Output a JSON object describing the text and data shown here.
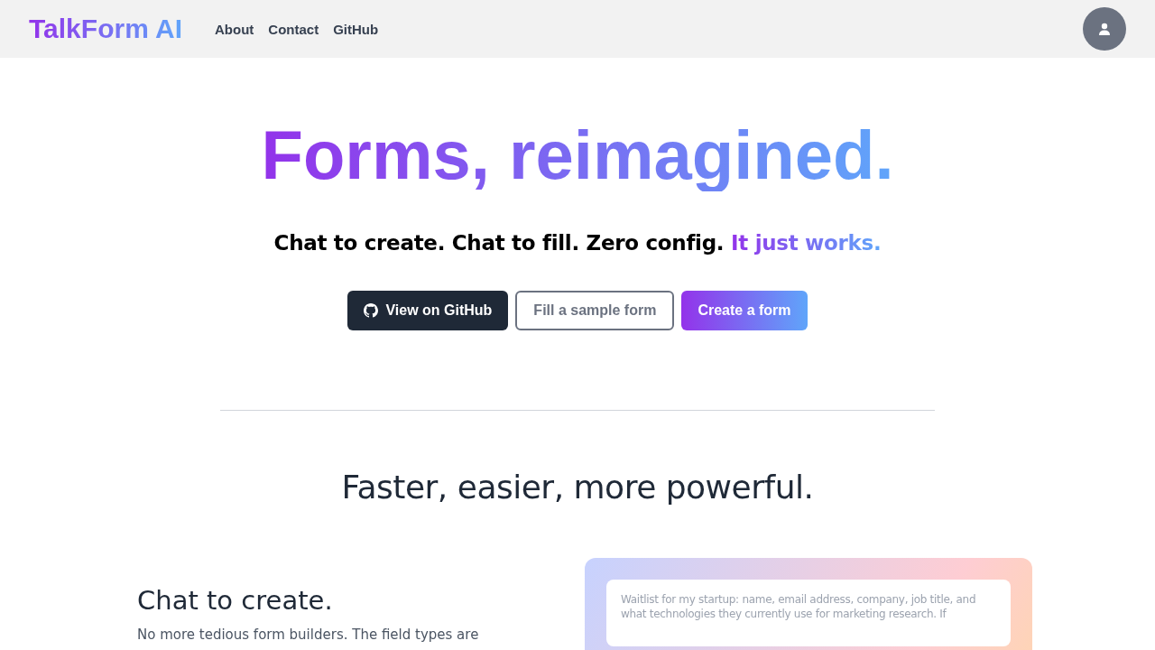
{
  "header": {
    "logo": "TalkForm AI",
    "nav": [
      {
        "label": "About"
      },
      {
        "label": "Contact"
      },
      {
        "label": "GitHub"
      }
    ]
  },
  "hero": {
    "title": "Forms, reimagined.",
    "subtitle_plain": "Chat to create. Chat to fill. Zero config.",
    "subtitle_accent": "It just works.",
    "buttons": [
      {
        "label": "View on GitHub",
        "kind": "dark"
      },
      {
        "label": "Fill a sample form",
        "kind": "outline"
      },
      {
        "label": "Create a form",
        "kind": "gradient"
      }
    ]
  },
  "features": {
    "heading": "Faster, easier, more powerful.",
    "section_title": "Chat to create.",
    "section_text": "No more tedious form builders. The field types are",
    "prompt_placeholder": "Waitlist for my startup: name, email address, company, job title, and what technologies they currently use for marketing research. If"
  }
}
